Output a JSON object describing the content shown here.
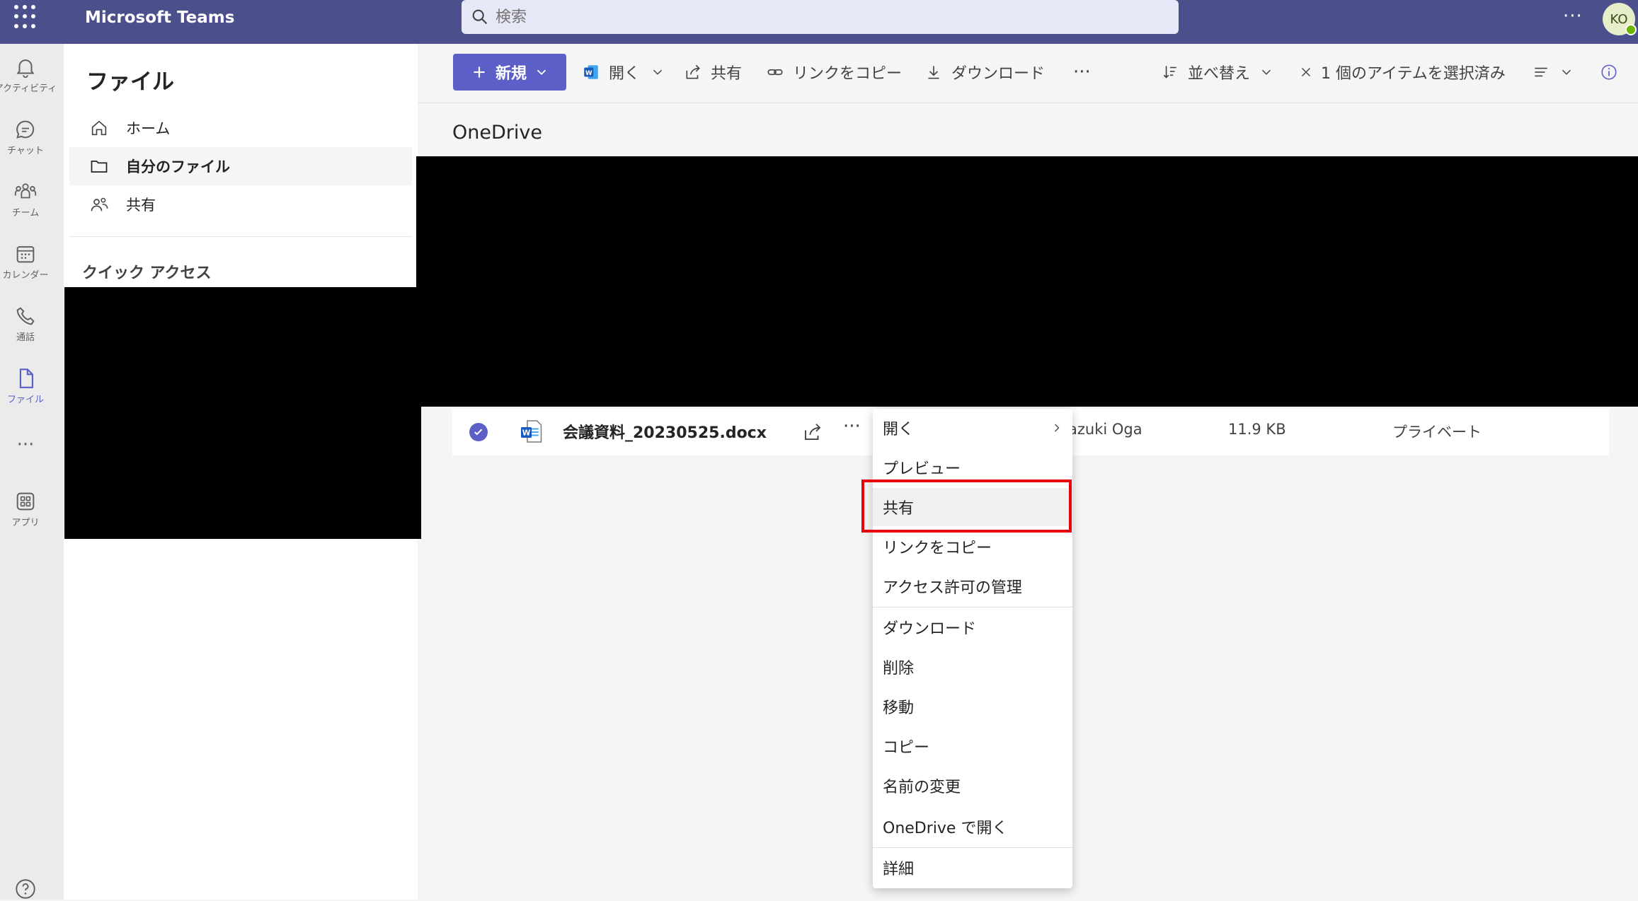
{
  "app": {
    "title": "Microsoft Teams",
    "avatar_initials": "KO"
  },
  "search": {
    "placeholder": "検索"
  },
  "rail": {
    "items": [
      {
        "label": "アクティビティ",
        "icon": "bell-icon"
      },
      {
        "label": "チャット",
        "icon": "chat-icon"
      },
      {
        "label": "チーム",
        "icon": "teams-icon"
      },
      {
        "label": "カレンダー",
        "icon": "calendar-icon"
      },
      {
        "label": "通話",
        "icon": "phone-icon"
      },
      {
        "label": "ファイル",
        "icon": "file-icon"
      },
      {
        "label": "アプリ",
        "icon": "apps-icon"
      }
    ],
    "more": "···"
  },
  "sidebar": {
    "heading": "ファイル",
    "items": [
      {
        "label": "ホーム"
      },
      {
        "label": "自分のファイル"
      },
      {
        "label": "共有"
      }
    ],
    "quick_access": "クイック アクセス"
  },
  "toolbar": {
    "new": "新規",
    "open": "開く",
    "share": "共有",
    "copy_link": "リンクをコピー",
    "download": "ダウンロード",
    "more": "···",
    "sort": "並べ替え",
    "selected": "1 個のアイテムを選択済み"
  },
  "location": "OneDrive",
  "file": {
    "name": "会議資料_20230525.docx",
    "owner": "azuki Oga",
    "size": "11.9 KB",
    "access": "プライベート"
  },
  "context_menu": {
    "items": [
      "開く",
      "プレビュー",
      "共有",
      "リンクをコピー",
      "アクセス許可の管理",
      "ダウンロード",
      "削除",
      "移動",
      "コピー",
      "名前の変更",
      "OneDrive で開く",
      "詳細"
    ],
    "highlighted": "共有"
  },
  "colors": {
    "brand": "#4b4f8c",
    "accent": "#5b5fc7",
    "highlight": "#e8000b",
    "word": "#185abd"
  }
}
